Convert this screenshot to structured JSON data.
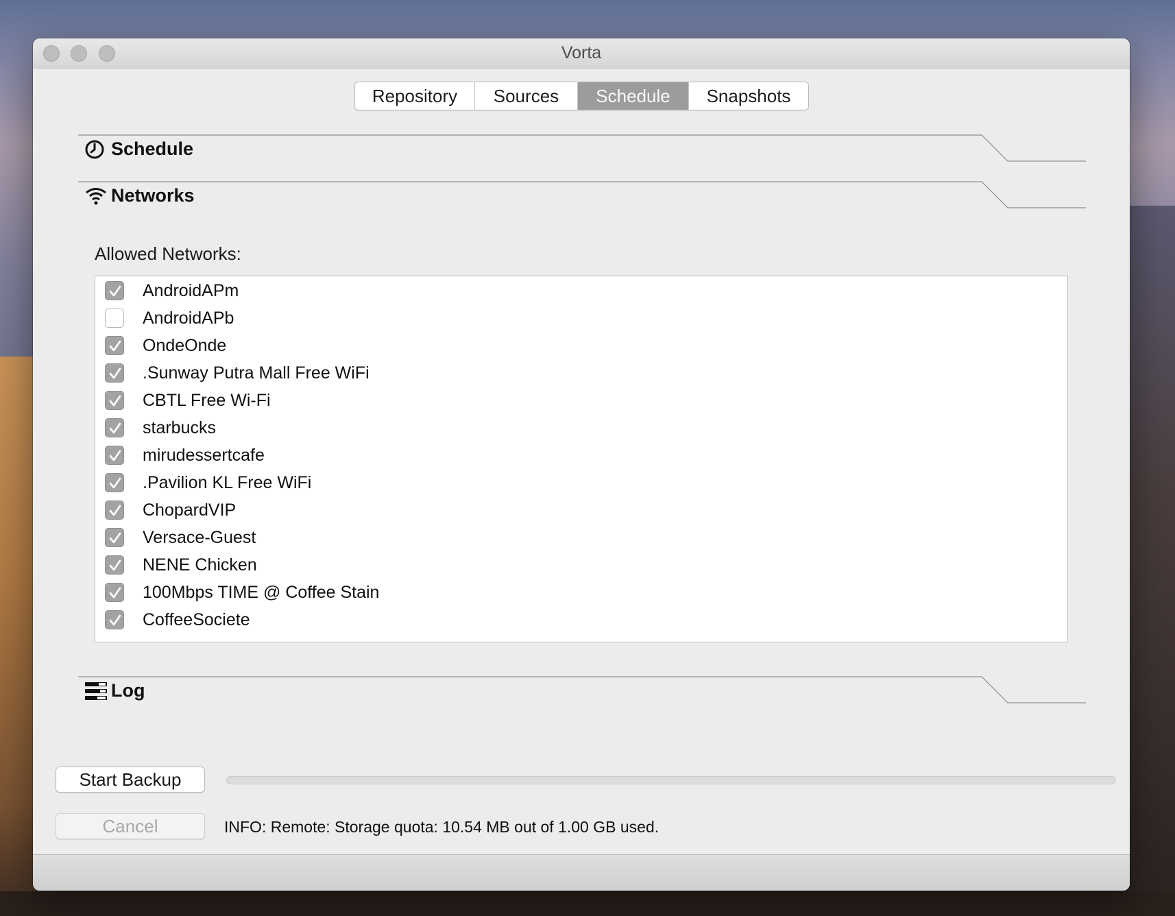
{
  "window": {
    "title": "Vorta"
  },
  "tabs": [
    {
      "label": "Repository",
      "active": false
    },
    {
      "label": "Sources",
      "active": false
    },
    {
      "label": "Schedule",
      "active": true
    },
    {
      "label": "Snapshots",
      "active": false
    }
  ],
  "sections": {
    "schedule": {
      "title": "Schedule",
      "icon": "clock-icon"
    },
    "networks": {
      "title": "Networks",
      "icon": "wifi-icon"
    },
    "log": {
      "title": "Log",
      "icon": "log-icon"
    }
  },
  "networks": {
    "label": "Allowed Networks:",
    "items": [
      {
        "name": "AndroidAPm",
        "checked": true
      },
      {
        "name": "AndroidAPb",
        "checked": false
      },
      {
        "name": "OndeOnde",
        "checked": true
      },
      {
        "name": ".Sunway Putra Mall Free WiFi",
        "checked": true
      },
      {
        "name": "CBTL Free Wi-Fi",
        "checked": true
      },
      {
        "name": "starbucks",
        "checked": true
      },
      {
        "name": "mirudessertcafe",
        "checked": true
      },
      {
        "name": ".Pavilion KL Free WiFi",
        "checked": true
      },
      {
        "name": "ChopardVIP",
        "checked": true
      },
      {
        "name": "Versace-Guest",
        "checked": true
      },
      {
        "name": "NENE Chicken",
        "checked": true
      },
      {
        "name": "100Mbps TIME @ Coffee Stain",
        "checked": true
      },
      {
        "name": "CoffeeSociete",
        "checked": true
      }
    ]
  },
  "actions": {
    "start_label": "Start Backup",
    "cancel_label": "Cancel",
    "progress_percent": 0,
    "status_text": "INFO: Remote: Storage quota: 10.54 MB out of 1.00 GB used."
  },
  "colors": {
    "active_tab": "#9c9c9c",
    "checkbox_checked": "#a3a3a3",
    "window_bg": "#ececec"
  }
}
